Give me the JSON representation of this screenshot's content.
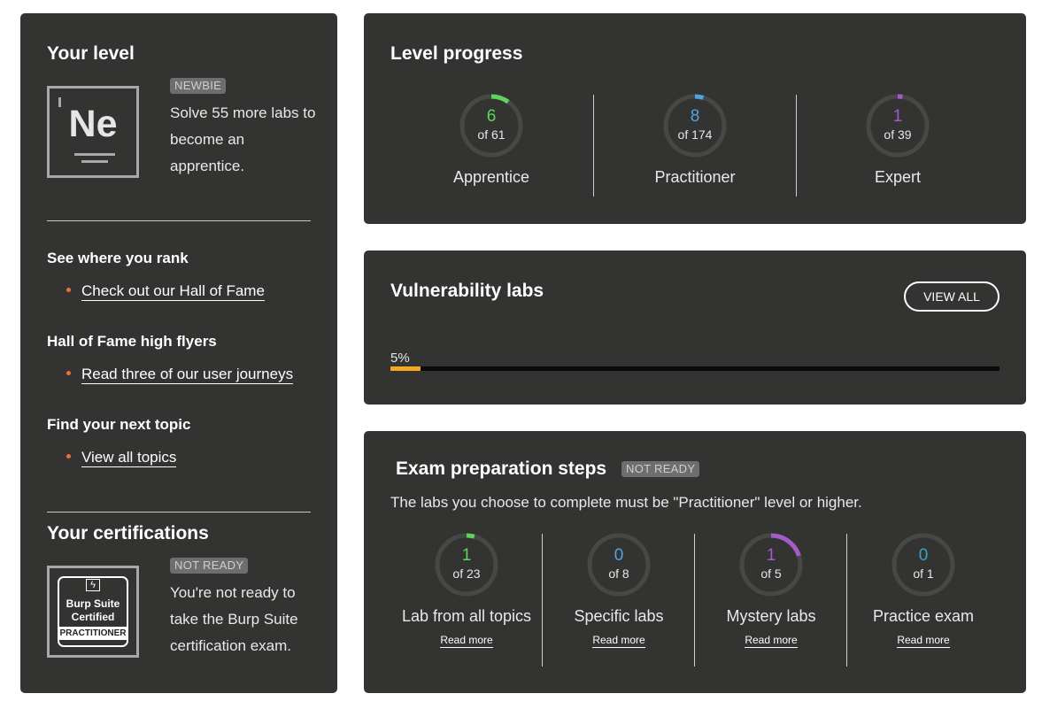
{
  "left": {
    "level_title": "Your level",
    "level_badge": "NEWBIE",
    "element_symbol": "Ne",
    "level_blurb": "Solve 55 more labs to become an apprentice.",
    "rank_heading": "See where you rank",
    "rank_link": "Check out our Hall of Fame",
    "flyers_heading": "Hall of Fame high flyers",
    "flyers_link": "Read three of our user journeys",
    "topic_heading": "Find your next topic",
    "topic_link": "View all topics",
    "cert_title": "Your certifications",
    "cert_badge": "NOT READY",
    "cert_logo_line1": "Burp Suite",
    "cert_logo_line2": "Certified",
    "cert_logo_tag": "PRACTITIONER",
    "cert_blurb": "You're not ready to take the Burp Suite certification exam."
  },
  "level_progress": {
    "title": "Level progress",
    "rings": [
      {
        "value": "6",
        "total": "of 61",
        "label": "Apprentice",
        "fraction": 0.098,
        "color": "#5ed45e"
      },
      {
        "value": "8",
        "total": "of 174",
        "label": "Practitioner",
        "fraction": 0.046,
        "color": "#4fa3e0"
      },
      {
        "value": "1",
        "total": "of 39",
        "label": "Expert",
        "fraction": 0.026,
        "color": "#a35cc7"
      }
    ]
  },
  "vulnerability_labs": {
    "title": "Vulnerability labs",
    "view_all_label": "VIEW ALL",
    "percent_label": "5%",
    "percent_value": 0.05
  },
  "exam": {
    "title": "Exam preparation steps",
    "badge": "NOT READY",
    "description": "The labs you choose to complete must be \"Practitioner\" level or higher.",
    "read_more_label": "Read more",
    "steps": [
      {
        "value": "1",
        "total": "of 23",
        "label": "Lab from all topics",
        "fraction": 0.043,
        "color": "#5ed45e"
      },
      {
        "value": "0",
        "total": "of 8",
        "label": "Specific labs",
        "fraction": 0,
        "color": "#4fa3e0"
      },
      {
        "value": "1",
        "total": "of 5",
        "label": "Mystery labs",
        "fraction": 0.2,
        "color": "#a35cc7"
      },
      {
        "value": "0",
        "total": "of 1",
        "label": "Practice exam",
        "fraction": 0,
        "color": "#38a3c7"
      }
    ]
  },
  "colors": {
    "panel": "#333332",
    "ring_track": "#474746",
    "bullet": "#e8703a",
    "progress_fill": "#f6a623"
  }
}
